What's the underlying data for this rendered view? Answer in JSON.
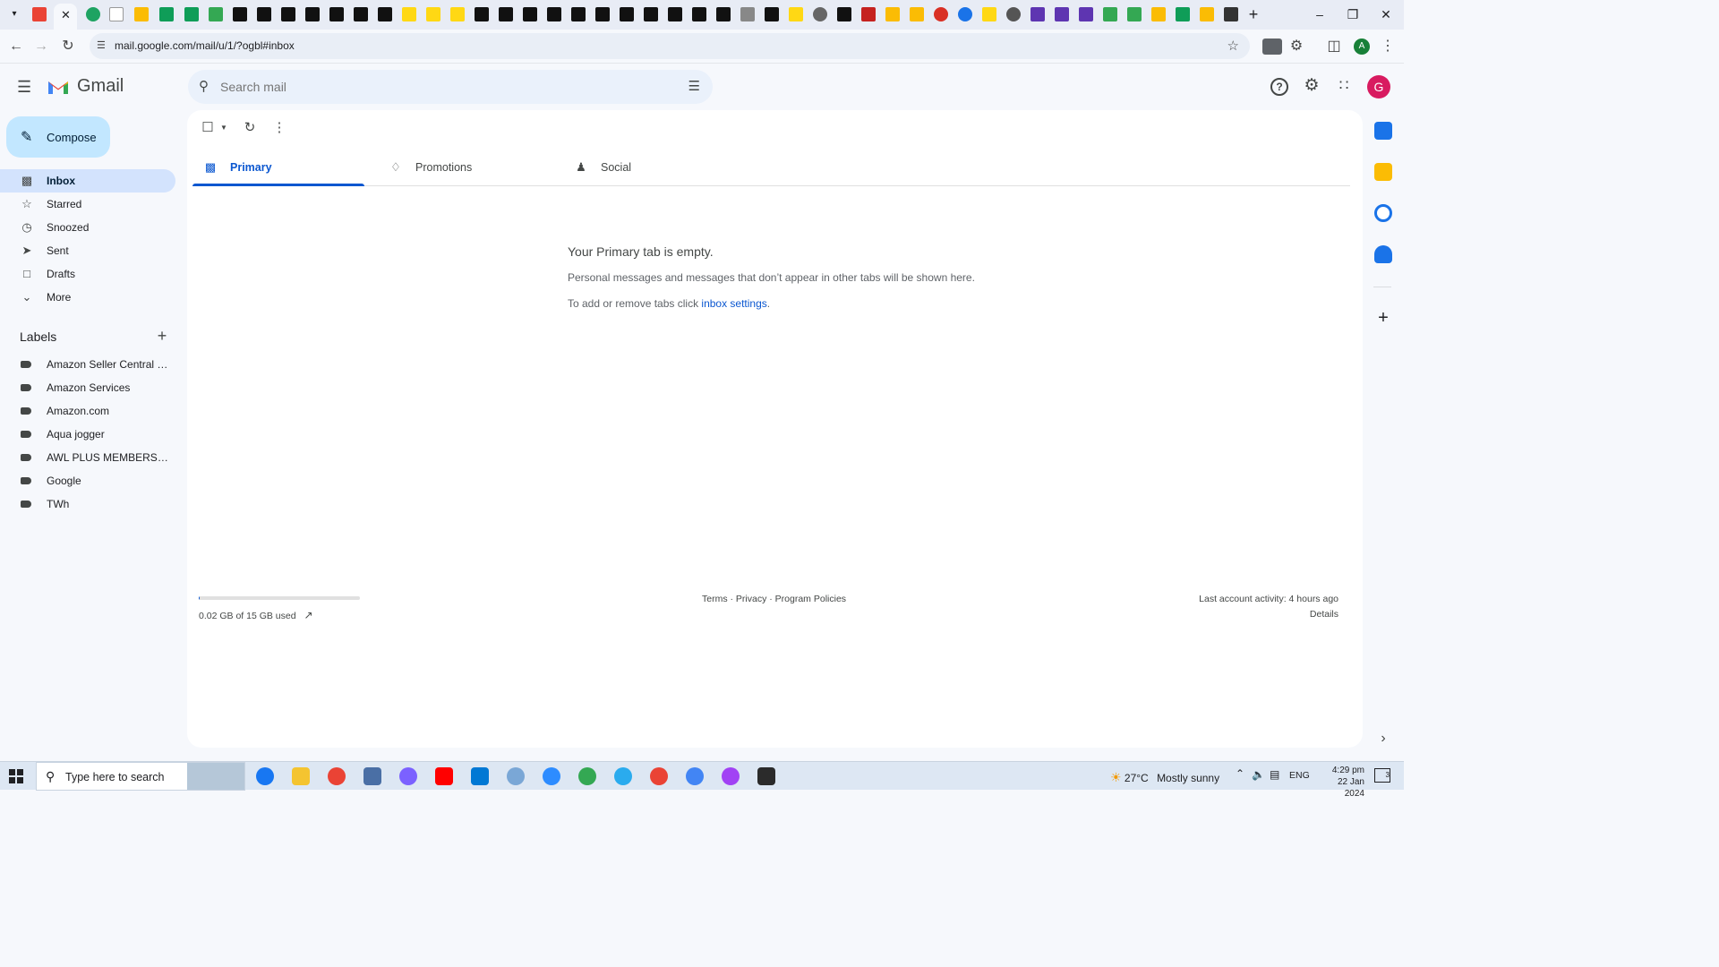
{
  "browser": {
    "url": "mail.google.com/mail/u/1/?ogbl#inbox",
    "profile_initial": "A"
  },
  "gmail": {
    "app_name": "Gmail",
    "search_placeholder": "Search mail",
    "avatar_initial": "G",
    "compose_label": "Compose"
  },
  "sidebar": {
    "items": [
      {
        "label": "Inbox",
        "icon": "inbox-icon",
        "active": true
      },
      {
        "label": "Starred",
        "icon": "star-icon"
      },
      {
        "label": "Snoozed",
        "icon": "clock-icon"
      },
      {
        "label": "Sent",
        "icon": "send-icon"
      },
      {
        "label": "Drafts",
        "icon": "draft-icon"
      },
      {
        "label": "More",
        "icon": "chevron-down-icon"
      }
    ],
    "labels_title": "Labels",
    "labels": [
      "Amazon Seller Central N...",
      "Amazon Services",
      "Amazon.com",
      "Aqua jogger",
      "AWL PLUS MEMBERSHIP",
      "Google",
      "TWh"
    ]
  },
  "tabs": [
    {
      "label": "Primary",
      "icon": "inbox-icon",
      "active": true
    },
    {
      "label": "Promotions",
      "icon": "tag-icon"
    },
    {
      "label": "Social",
      "icon": "people-icon"
    }
  ],
  "empty": {
    "title": "Your Primary tab is empty.",
    "body": "Personal messages and messages that don’t appear in other tabs will be shown here.",
    "settings_prefix": "To add or remove tabs click ",
    "settings_link": "inbox settings",
    "settings_suffix": "."
  },
  "footer": {
    "storage_text": "0.02 GB of 15 GB used",
    "storage_fraction": 0.0013,
    "links": "Terms · Privacy · Program Policies",
    "activity": "Last account activity: 4 hours ago",
    "details": "Details"
  },
  "taskbar": {
    "search_placeholder": "Type here to search",
    "weather_temp": "27°C",
    "weather_text": "Mostly sunny",
    "lang": "ENG",
    "time": "4:29 pm",
    "date": "22 Jan 2024",
    "notification_count": "3"
  },
  "colors": {
    "accent": "#0b57d0",
    "compose_bg": "#c2e7ff",
    "active_nav": "#d3e3fd",
    "avatar": "#d81b60"
  }
}
